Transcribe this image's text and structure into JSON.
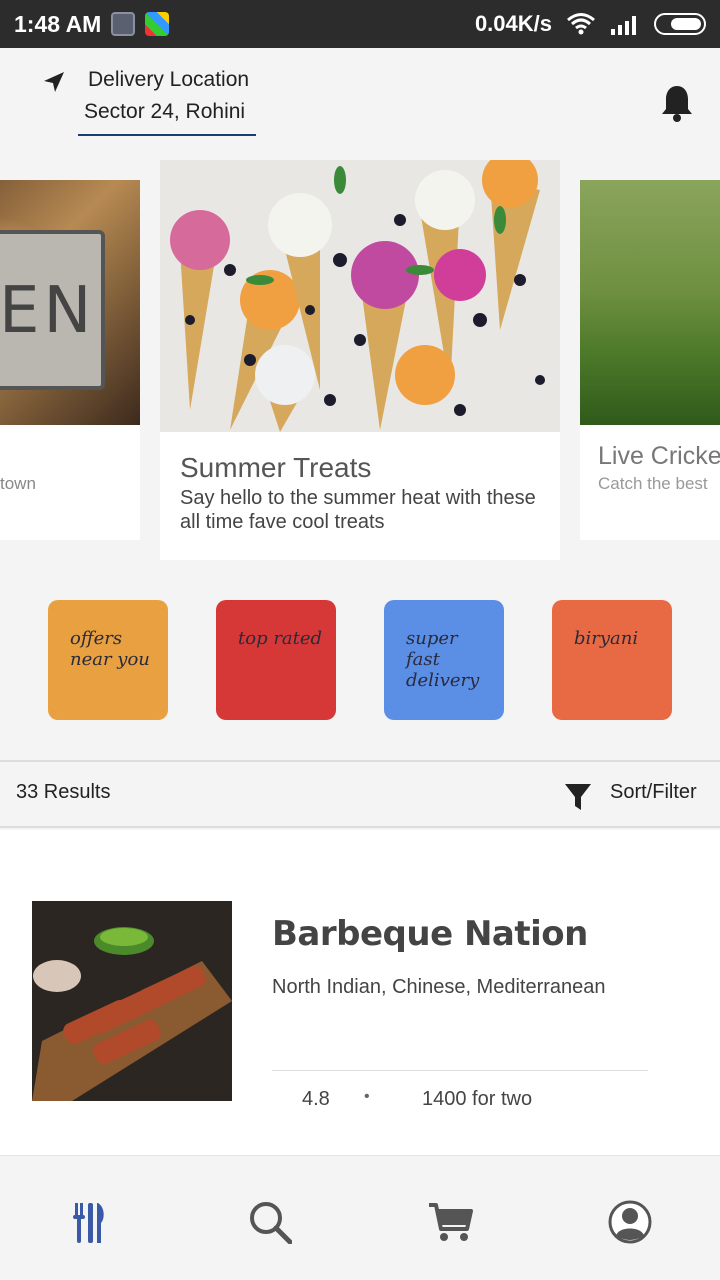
{
  "status_bar": {
    "time": "1:48 AM",
    "network_speed": "0.04K/s"
  },
  "header": {
    "location_label": "Delivery Location",
    "location_value": "Sector 24, Rohini",
    "icons": [
      "navigation-arrow-icon",
      "bell-icon"
    ]
  },
  "carousel": {
    "left": {
      "subtitle": "town"
    },
    "main": {
      "title": "Summer Treats",
      "description": "Say hello to the summer heat with these all time fave cool treats"
    },
    "right": {
      "title": "Live Cricke",
      "subtitle": "Catch the best"
    }
  },
  "categories": [
    {
      "label": "offers near you",
      "color": "#E8A040"
    },
    {
      "label": "top rated",
      "color": "#D63838"
    },
    {
      "label": "super fast delivery",
      "color": "#5B8FE6"
    },
    {
      "label": "biryani",
      "color": "#E86A44"
    }
  ],
  "results": {
    "count_label": "33 Results",
    "filter_label": "Sort/Filter"
  },
  "restaurant": {
    "name": "Barbeque Nation",
    "cuisines": "North Indian, Chinese, Mediterranean",
    "rating": "4.8",
    "separator": "•",
    "cost": "1400 for two"
  },
  "bottom_nav": {
    "items": [
      {
        "icon": "cutlery-icon",
        "active": true,
        "color": "#3a5aa8"
      },
      {
        "icon": "search-icon",
        "active": false,
        "color": "#555555"
      },
      {
        "icon": "cart-icon",
        "active": false,
        "color": "#555555"
      },
      {
        "icon": "profile-icon",
        "active": false,
        "color": "#555555"
      }
    ]
  }
}
